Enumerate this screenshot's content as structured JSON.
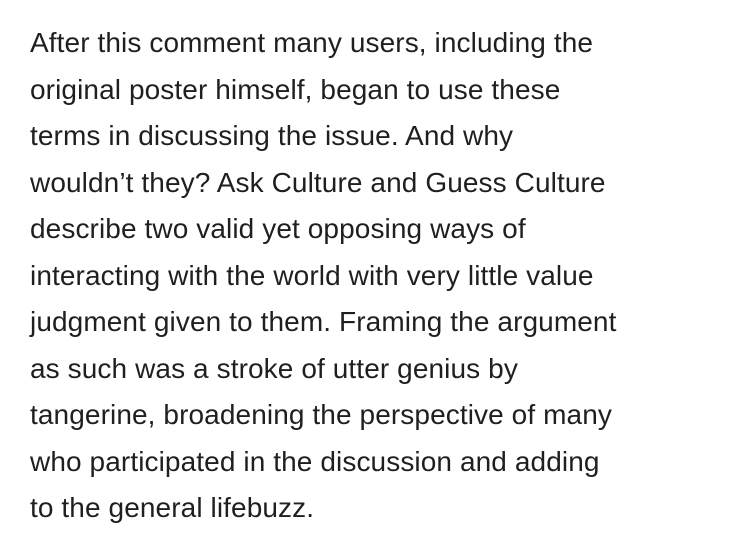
{
  "post": {
    "lines": [
      "After this comment many users, including the",
      "original poster himself, began to use these",
      "terms in discussing the issue. And why",
      "wouldn’t they? Ask Culture and Guess Culture",
      "describe two valid yet opposing ways of",
      "interacting with the world with very little value",
      "judgment given to them. Framing the argument",
      "as such was a stroke of utter genius by",
      "tangerine, broadening the perspective of many",
      "who participated in the discussion and adding",
      "to the general lifebuzz."
    ]
  }
}
